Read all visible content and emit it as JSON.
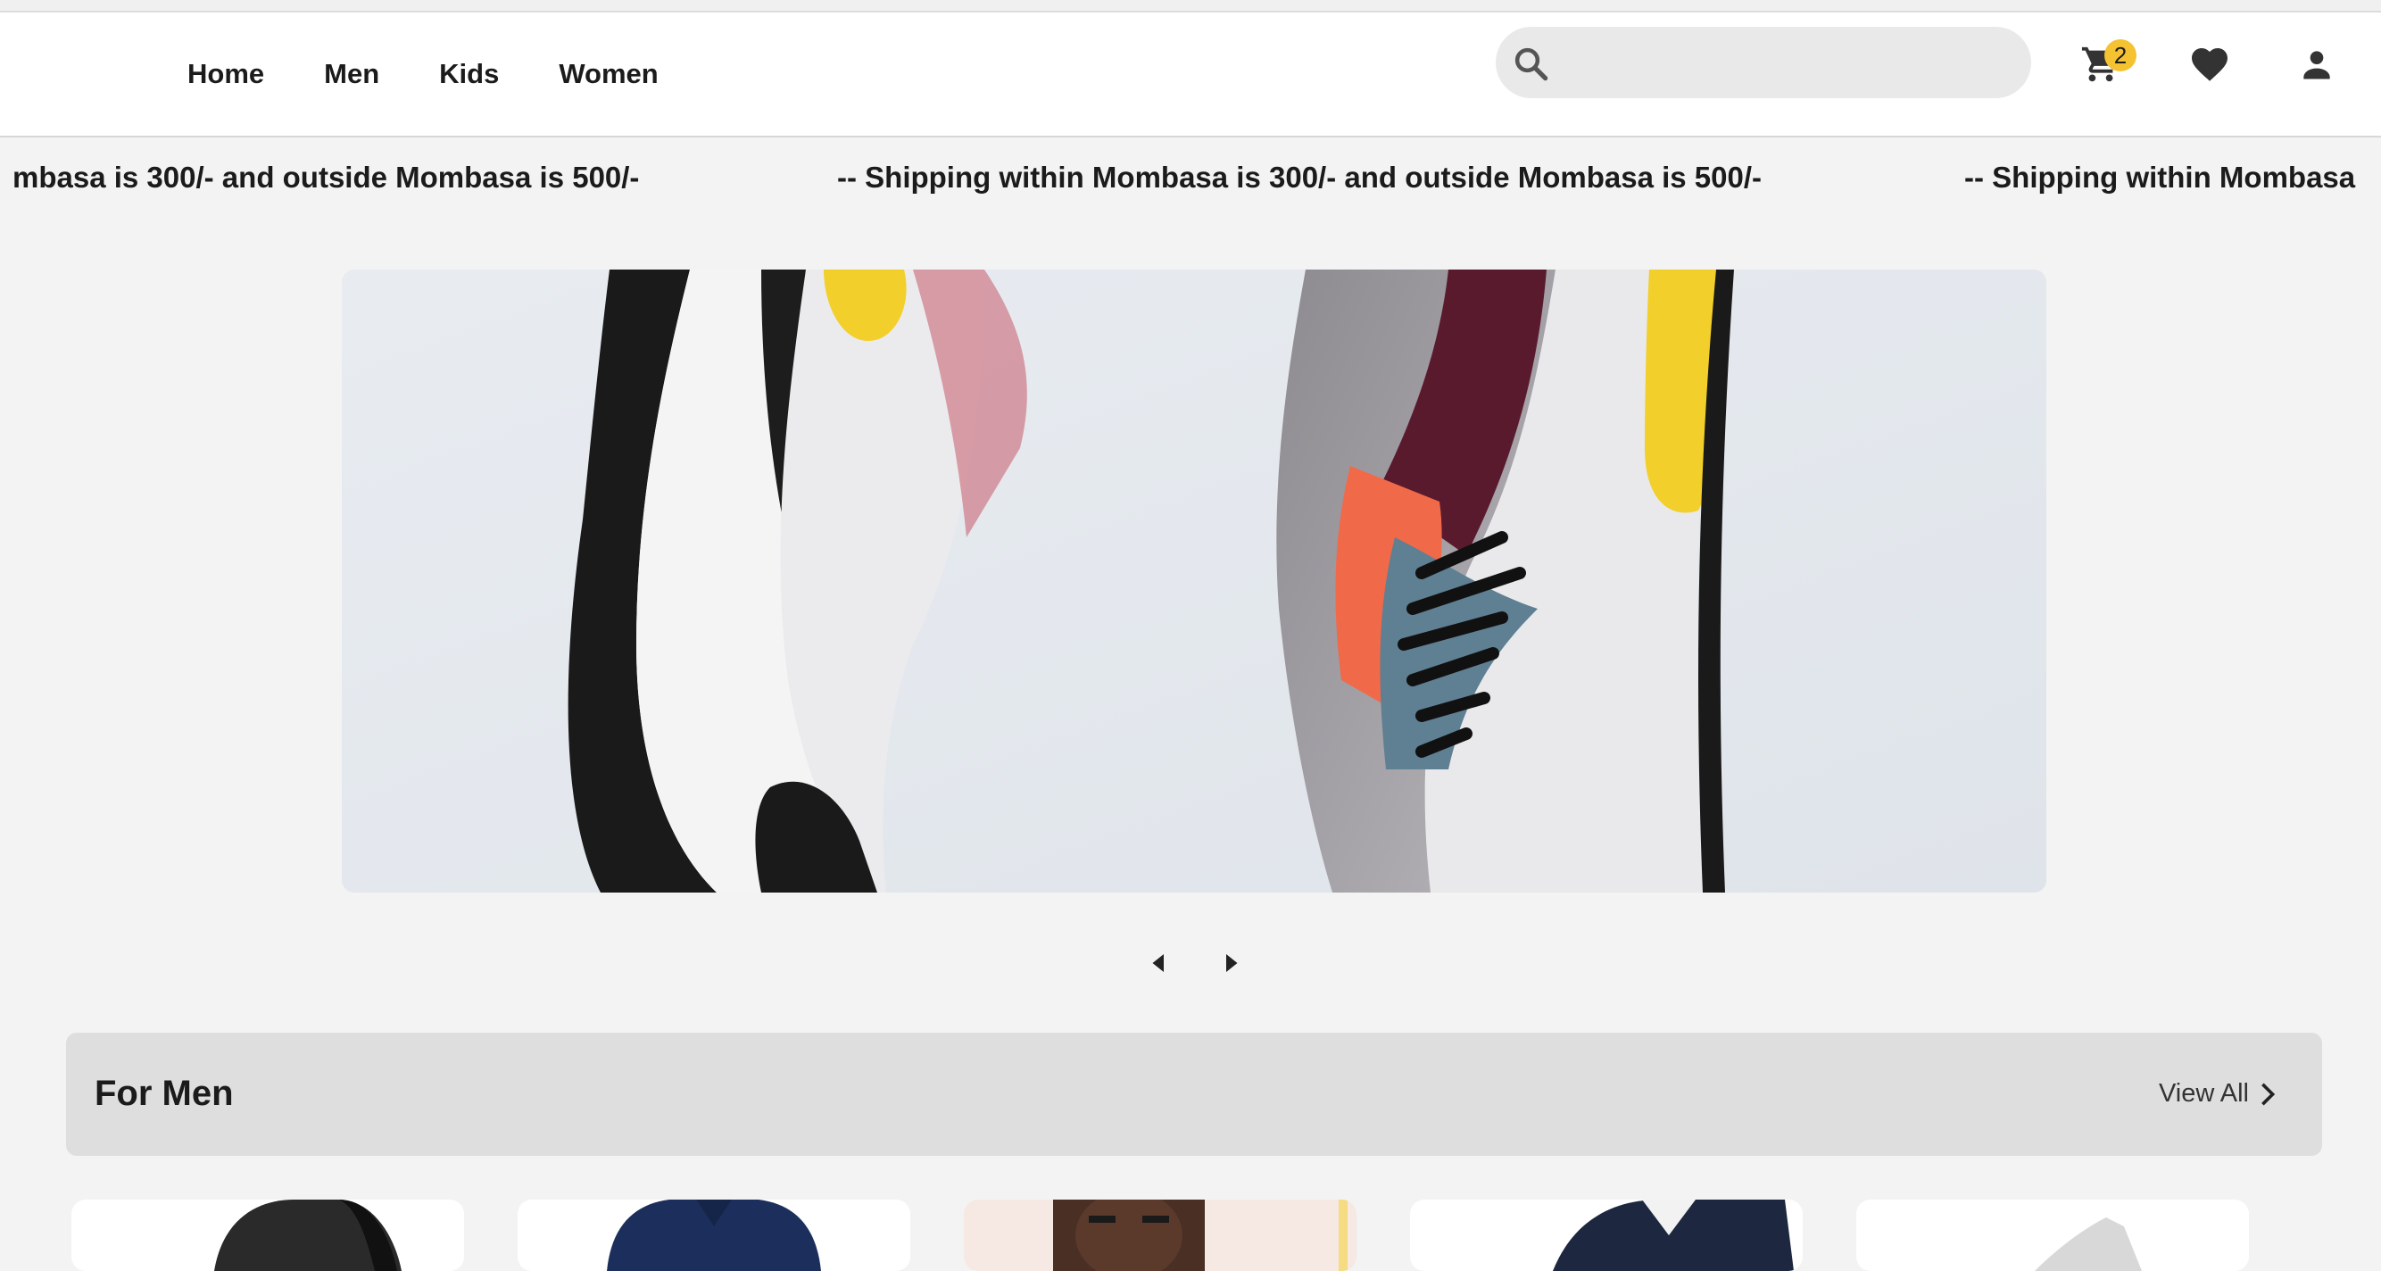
{
  "nav": {
    "links": [
      "Home",
      "Men",
      "Kids",
      "Women"
    ]
  },
  "search": {
    "placeholder": ""
  },
  "cart": {
    "count": "2"
  },
  "marquee": {
    "segments": [
      "mbasa is 300/- and outside Mombasa is 500/-",
      "-- Shipping within Mombasa is 300/- and outside Mombasa is 500/-",
      "-- Shipping within Mombasa"
    ]
  },
  "hero": {
    "image": "sneakers-banner"
  },
  "carousel": {
    "prev_icon": "caret-left-icon",
    "next_icon": "caret-right-icon"
  },
  "section": {
    "title": "For Men",
    "view_all": "View All"
  },
  "products": [
    {
      "image": "belt-product"
    },
    {
      "image": "navy-shirt-product"
    },
    {
      "image": "model-portrait-product"
    },
    {
      "image": "dark-shirts-product"
    },
    {
      "image": "white-sneaker-product"
    }
  ],
  "colors": {
    "accent": "#f5c232",
    "background": "#f3f3f3",
    "header_bar": "#dedede"
  }
}
